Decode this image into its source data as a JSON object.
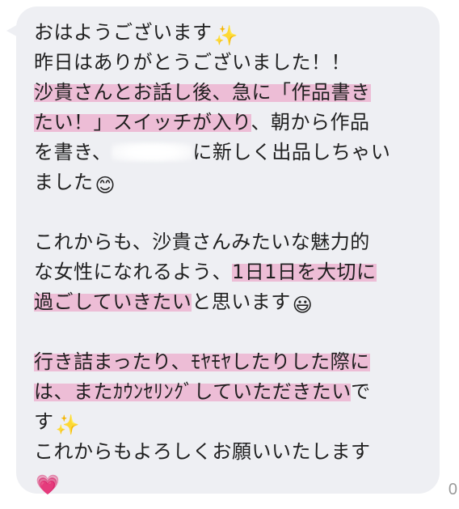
{
  "message": {
    "l1": "おはようございます",
    "l2": "昨日はありがとうございました！！",
    "l3": "沙貴さんとお話し後、急に「作品書き",
    "l4a": "たい！」スイッチが入り",
    "l4b": "、朝から作品",
    "l5a": "を書き、",
    "l5b": "に新しく出品しちゃい",
    "l6": "ました",
    "l7": "これからも、沙貴さんみたいな魅力的",
    "l8a": "な女性になれるよう、",
    "l8b": "1日1日を大切に",
    "l9a": "過ごしていきたい",
    "l9b": "と思います",
    "l10": "行き詰まったり、ﾓﾔﾓﾔしたりした際に",
    "l11a": "は、またｶｳﾝｾﾘﾝｸﾞしていただきたい",
    "l11b": "で",
    "l12": "す",
    "l13": "これからもよろしくお願いいたします"
  },
  "emoji": {
    "sparkles": "✨",
    "smile": "😊",
    "grin": "😃",
    "heart": "💗"
  },
  "read_count": "0",
  "colors": {
    "bubble": "#eeeff3",
    "highlight": "#ec94be",
    "text": "#1f1f1f"
  }
}
